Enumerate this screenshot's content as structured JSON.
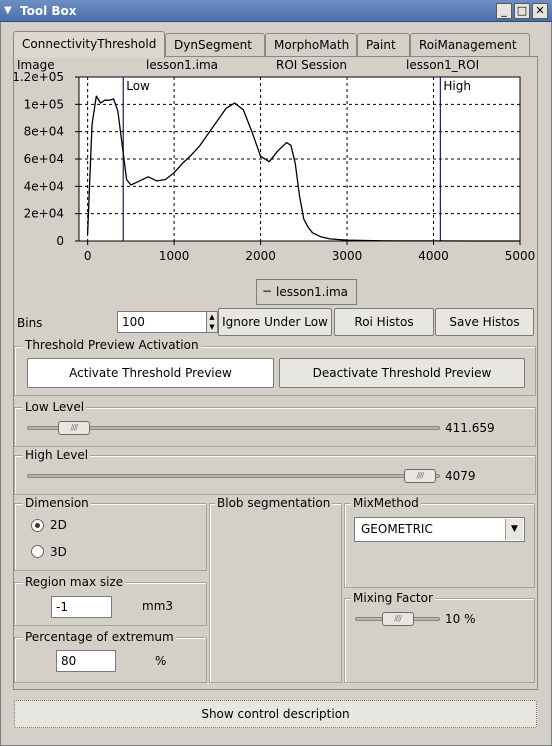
{
  "window": {
    "title": "Tool Box",
    "minimize": "_",
    "maximize": "□",
    "close": "✕"
  },
  "tabs": [
    {
      "label": "ConnectivityThreshold",
      "active": true
    },
    {
      "label": "DynSegment"
    },
    {
      "label": "MorphoMath"
    },
    {
      "label": "Paint"
    },
    {
      "label": "RoiManagement"
    }
  ],
  "header": {
    "image_label": "Image",
    "image_name": "lesson1.ima",
    "roi_session": "ROI Session",
    "roi_name": "lesson1_ROI"
  },
  "chart_data": {
    "type": "line",
    "x": [
      0,
      50,
      100,
      150,
      200,
      250,
      300,
      350,
      400,
      450,
      500,
      600,
      700,
      800,
      900,
      1000,
      1100,
      1200,
      1300,
      1400,
      1500,
      1600,
      1700,
      1800,
      1900,
      2000,
      2100,
      2200,
      2300,
      2350,
      2400,
      2450,
      2500,
      2550,
      2600,
      2700,
      2800,
      3000,
      3300,
      3600,
      4000,
      4500,
      5000
    ],
    "series": [
      {
        "values": [
          5000,
          85000,
          106000,
          101000,
          103000,
          103000,
          104000,
          95000,
          70000,
          45000,
          41000,
          44000,
          47000,
          44000,
          45000,
          50000,
          57000,
          63000,
          70000,
          79000,
          88000,
          97000,
          101000,
          96000,
          80000,
          62000,
          58000,
          66000,
          72000,
          70000,
          57000,
          33000,
          16000,
          10000,
          6000,
          3000,
          1500,
          600,
          200,
          100,
          50,
          0,
          0
        ]
      }
    ],
    "xlim": [
      -100,
      5000
    ],
    "ylim": [
      0,
      120000
    ],
    "xticks": [
      "0",
      "1000",
      "2000",
      "3000",
      "4000",
      "5000"
    ],
    "xtick_values": [
      0,
      1000,
      2000,
      3000,
      4000,
      5000
    ],
    "yticks": [
      "0",
      "2e+04",
      "4e+04",
      "6e+04",
      "8e+04",
      "1e+05",
      "1.2e+05"
    ],
    "ytick_values": [
      0,
      20000,
      40000,
      60000,
      80000,
      100000,
      120000
    ],
    "low_marker": {
      "label": "Low",
      "x": 411.659
    },
    "high_marker": {
      "label": "High",
      "x": 4079
    },
    "grid": true,
    "legend": {
      "marker": "−",
      "label": "lesson1.ima",
      "placement": "bottom-center"
    },
    "line_color": "#000000",
    "marker_color": "#1a1a6e"
  },
  "bins": {
    "label": "Bins",
    "value": "100"
  },
  "buttons": {
    "ignore_under_low": "Ignore Under Low",
    "roi_histos": "Roi Histos",
    "save_histos": "Save Histos",
    "activate_preview": "Activate Threshold Preview",
    "deactivate_preview": "Deactivate Threshold Preview",
    "show_control_description": "Show control description"
  },
  "threshold_preview": {
    "title": "Threshold Preview Activation"
  },
  "low_level": {
    "title": "Low Level",
    "value": "411.659",
    "fraction": 0.081
  },
  "high_level": {
    "title": "High Level",
    "value": "4079",
    "fraction": 0.989
  },
  "dimension": {
    "title": "Dimension",
    "options": [
      "2D",
      "3D"
    ],
    "selected": "2D"
  },
  "blob_segmentation": {
    "title": "Blob segmentation"
  },
  "mix_method": {
    "title": "MixMethod",
    "value": "GEOMETRIC"
  },
  "region_max_size": {
    "title": "Region max size",
    "value": "-1",
    "unit": "mm3"
  },
  "mixing_factor": {
    "title": "Mixing Factor",
    "value": "10 %",
    "fraction": 0.5
  },
  "percentage_extremum": {
    "title": "Percentage of extremum",
    "value": "80",
    "unit": "%"
  }
}
